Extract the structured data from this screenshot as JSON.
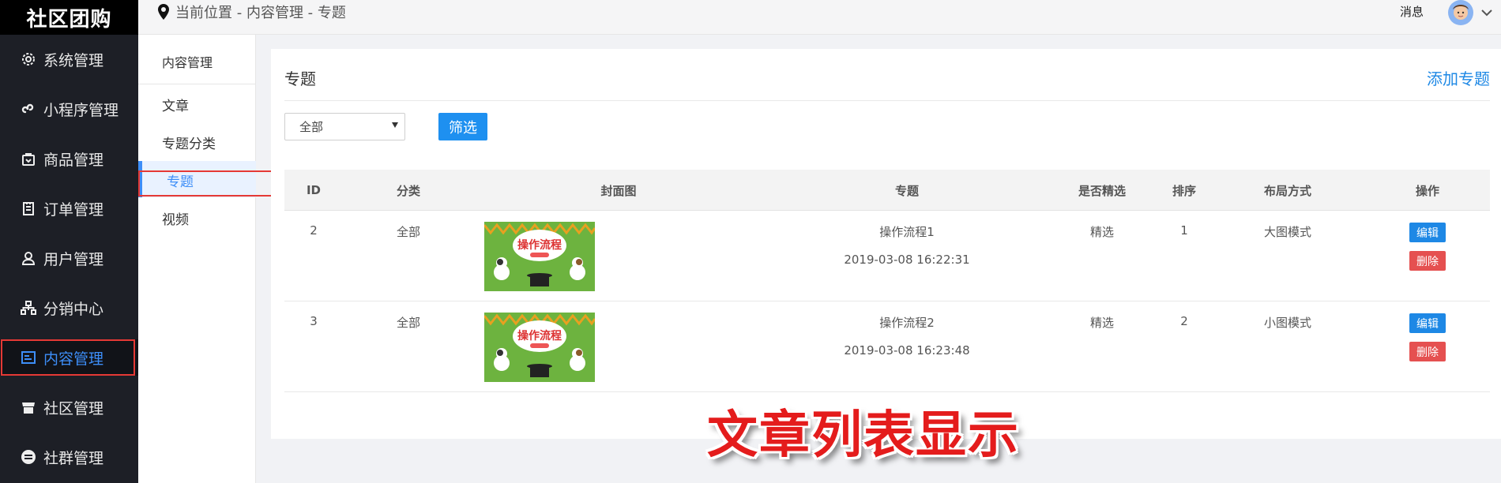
{
  "sidebar": {
    "brand": "社区团购",
    "items": [
      {
        "label": "系统管理",
        "icon": "gear-icon"
      },
      {
        "label": "小程序管理",
        "icon": "mini-program-icon"
      },
      {
        "label": "商品管理",
        "icon": "shopping-bag-icon"
      },
      {
        "label": "订单管理",
        "icon": "order-list-icon"
      },
      {
        "label": "用户管理",
        "icon": "user-icon"
      },
      {
        "label": "分销中心",
        "icon": "org-chart-icon"
      },
      {
        "label": "内容管理",
        "icon": "content-icon",
        "active": true
      },
      {
        "label": "社区管理",
        "icon": "store-icon"
      },
      {
        "label": "社群管理",
        "icon": "group-icon"
      }
    ]
  },
  "topbar": {
    "breadcrumb": "当前位置 - 内容管理 - 专题",
    "message": "消息"
  },
  "submenu": {
    "title": "内容管理",
    "items": [
      "文章",
      "专题分类",
      "专题",
      "视频"
    ],
    "active": "专题"
  },
  "panel": {
    "title": "专题",
    "add_label": "添加专题",
    "filter_value": "全部",
    "filter_button": "筛选"
  },
  "table": {
    "headers": [
      "ID",
      "分类",
      "封面图",
      "专题",
      "是否精选",
      "排序",
      "布局方式",
      "操作"
    ],
    "rows": [
      {
        "id": "2",
        "category": "全部",
        "cover_text": "操作流程",
        "topic": "操作流程1",
        "time": "2019-03-08 16:22:31",
        "featured": "精选",
        "order": "1",
        "layout": "大图模式",
        "edit": "编辑",
        "delete": "删除"
      },
      {
        "id": "3",
        "category": "全部",
        "cover_text": "操作流程",
        "topic": "操作流程2",
        "time": "2019-03-08 16:23:48",
        "featured": "精选",
        "order": "2",
        "layout": "小图模式",
        "edit": "编辑",
        "delete": "删除"
      }
    ]
  },
  "overlay_caption": "文章列表显示",
  "colors": {
    "accent": "#1e88e5",
    "danger": "#e55050",
    "sidebar_bg": "#1d1f26",
    "highlight": "#e53935"
  }
}
